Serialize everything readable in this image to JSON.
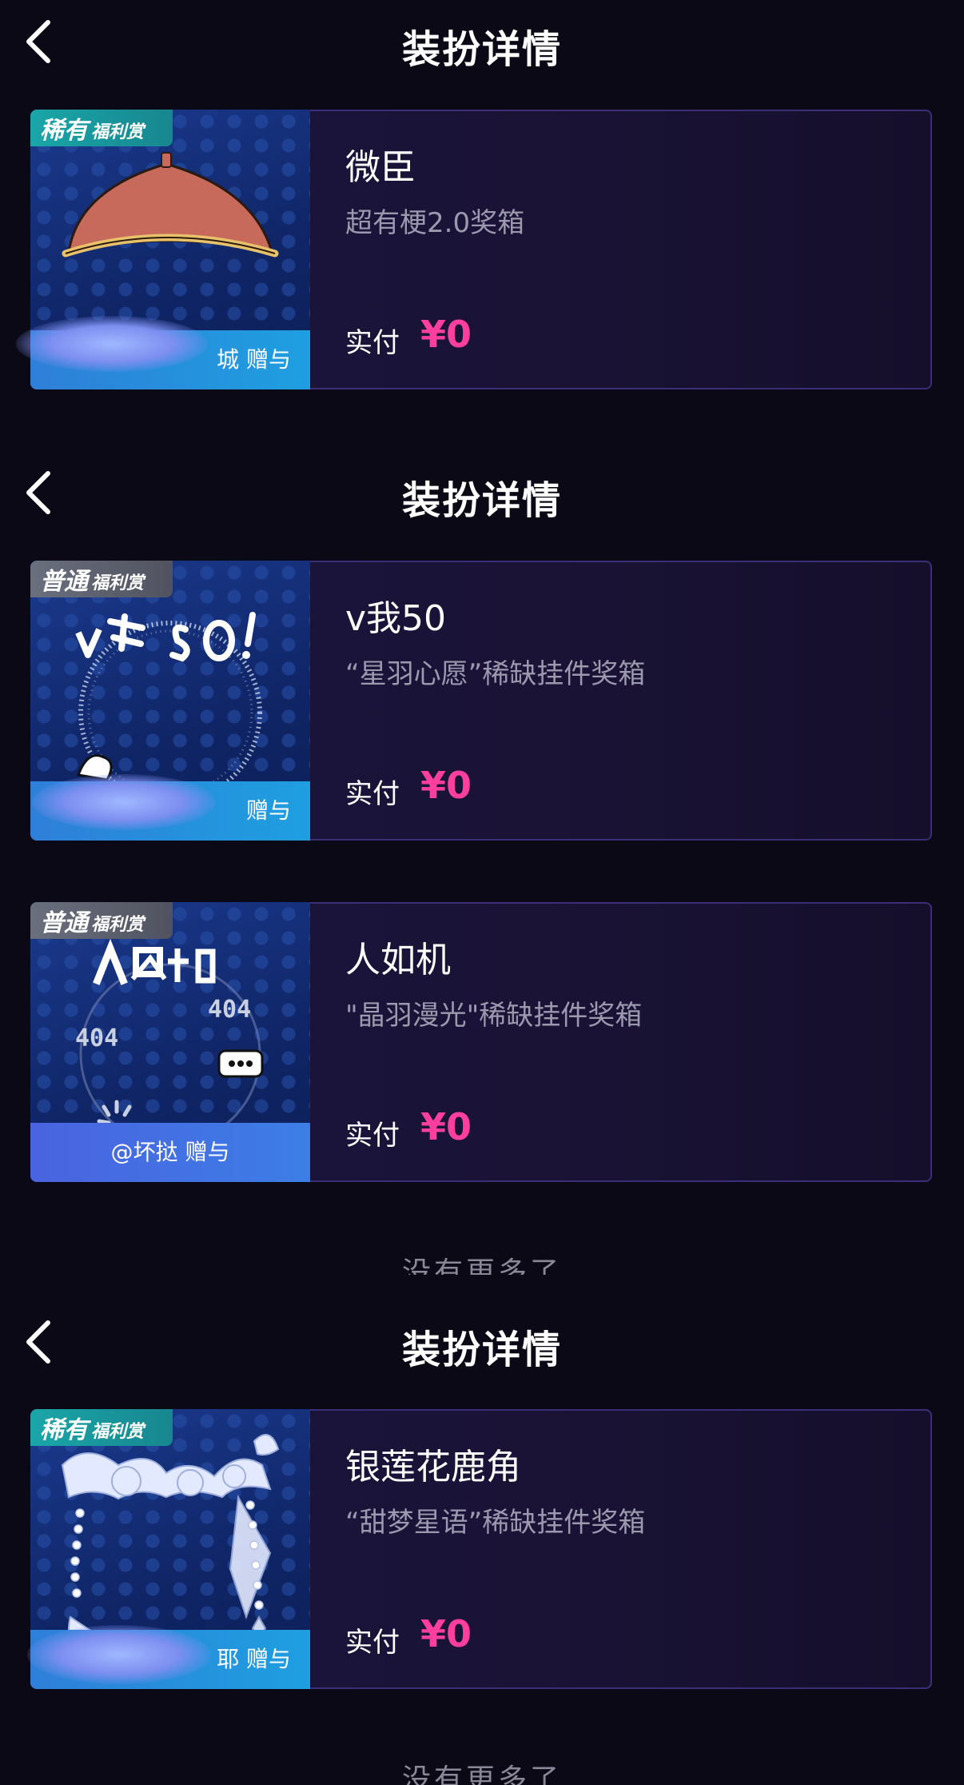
{
  "screens": [
    {
      "header": {
        "title": "装扮详情"
      },
      "cards": [
        {
          "rarity_main": "稀有",
          "rarity_sub": "福利赏",
          "rarity_type": "rare",
          "art_icon": "red-hat-icon",
          "name": "微臣",
          "source": "超有梗2.0奖箱",
          "pay_label": "实付",
          "pay_amount": "¥0",
          "gift_text": "城 赠与"
        }
      ]
    },
    {
      "header": {
        "title": "装扮详情"
      },
      "cards": [
        {
          "rarity_main": "普通",
          "rarity_sub": "福利赏",
          "rarity_type": "normal",
          "art_icon": "v50-frame-icon",
          "name": "v我50",
          "source": "“星羽心愿”稀缺挂件奖箱",
          "pay_label": "实付",
          "pay_amount": "¥0",
          "gift_text": "赠与"
        },
        {
          "rarity_main": "普通",
          "rarity_sub": "福利赏",
          "rarity_type": "normal",
          "art_icon": "pixel-404-frame-icon",
          "name": "人如机",
          "source": "\"晶羽漫光\"稀缺挂件奖箱",
          "pay_label": "实付",
          "pay_amount": "¥0",
          "gift_text": "@坏挞 赠与"
        }
      ],
      "no_more": "没有更多了"
    },
    {
      "header": {
        "title": "装扮详情"
      },
      "cards": [
        {
          "rarity_main": "稀有",
          "rarity_sub": "福利赏",
          "rarity_type": "rare",
          "art_icon": "silver-lotus-antler-icon",
          "name": "银莲花鹿角",
          "source": "“甜梦星语”稀缺挂件奖箱",
          "pay_label": "实付",
          "pay_amount": "¥0",
          "gift_text": "耶 赠与"
        }
      ],
      "no_more": "没有更多了"
    }
  ],
  "colors": {
    "background": "#0b0915",
    "price": "#ff3f9e",
    "rare_badge": "#1aa6a8",
    "normal_badge": "#6a6f7e"
  }
}
